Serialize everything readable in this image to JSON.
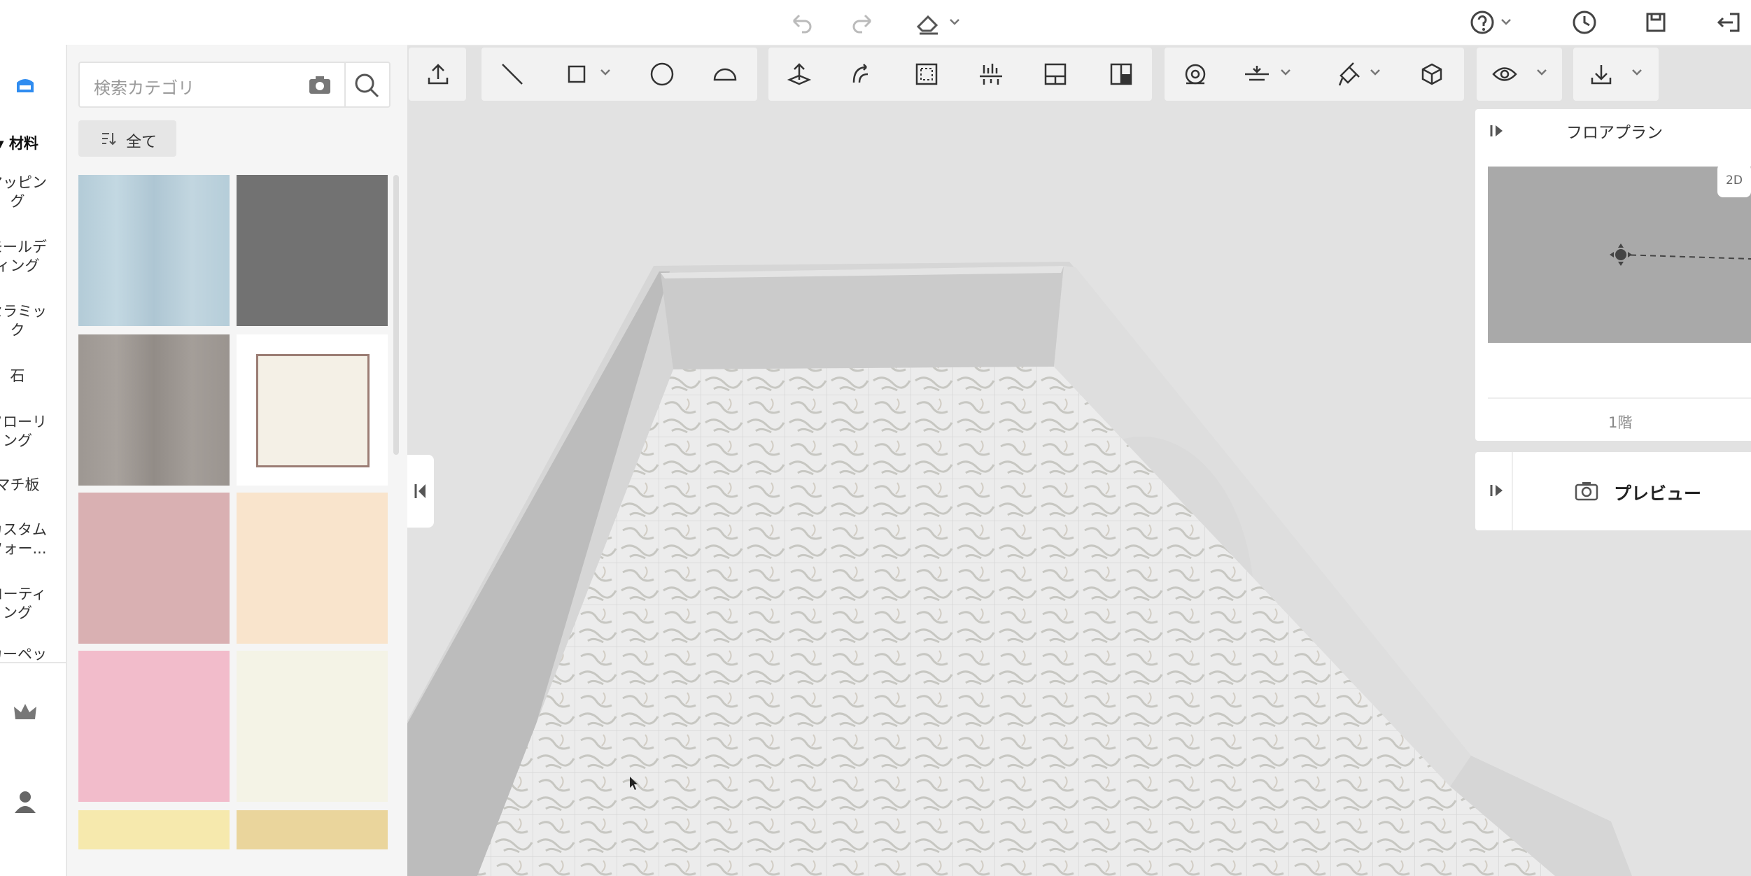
{
  "topbar": {
    "icons": [
      "undo-icon",
      "redo-icon",
      "eraser-icon",
      "help-icon",
      "history-icon",
      "save-icon",
      "exit-icon"
    ]
  },
  "rail": {
    "items": [
      {
        "label": "材料",
        "active": true
      },
      {
        "label": "マッピング"
      },
      {
        "label": "モールディング"
      },
      {
        "label": "セラミック"
      },
      {
        "label": "石"
      },
      {
        "label": "フローリング"
      },
      {
        "label": "マチ板"
      },
      {
        "label": "カスタムフォー..."
      },
      {
        "label": "コーティング"
      },
      {
        "label": "カーペット"
      }
    ],
    "item_lines": [
      [
        "▾ 材料"
      ],
      [
        "マッピン",
        "グ"
      ],
      [
        "モールデ",
        "ィング"
      ],
      [
        "セラミッ",
        "ク"
      ],
      [
        "石"
      ],
      [
        "フローリ",
        "ング"
      ],
      [
        "マチ板"
      ],
      [
        "カスタム",
        "フォー..."
      ],
      [
        "コーティ",
        "ング"
      ],
      [
        "カーペッ"
      ]
    ]
  },
  "catalog": {
    "search_placeholder": "検索カテゴリ",
    "filter_label": "全て",
    "swatch_colors": [
      "#b8cfda",
      "#727272",
      "#9b9590",
      "#f4f0e6",
      "#d9b0b2",
      "#f9e4cc",
      "#f2bccb",
      "#f4f3e6",
      "#f6e9ad",
      "#ead59c"
    ]
  },
  "toolbar": {
    "icons": [
      "upload-icon",
      "line-icon",
      "rectangle-icon",
      "circle-icon",
      "arc-icon",
      "move-point-icon",
      "snap-icon",
      "select-area-icon",
      "align-icon",
      "split-icon",
      "layout-icon",
      "tape-measure-icon",
      "level-icon",
      "paint-icon",
      "cube-icon",
      "eye-icon",
      "download-icon"
    ]
  },
  "floorplan": {
    "title": "フロアプラン",
    "badge": "2D",
    "level": "1階"
  },
  "preview": {
    "label": "プレビュー"
  },
  "colors": {
    "accent": "#2f8cf0",
    "floor_tile": "#ededed",
    "wall": "#cfcfcf"
  }
}
